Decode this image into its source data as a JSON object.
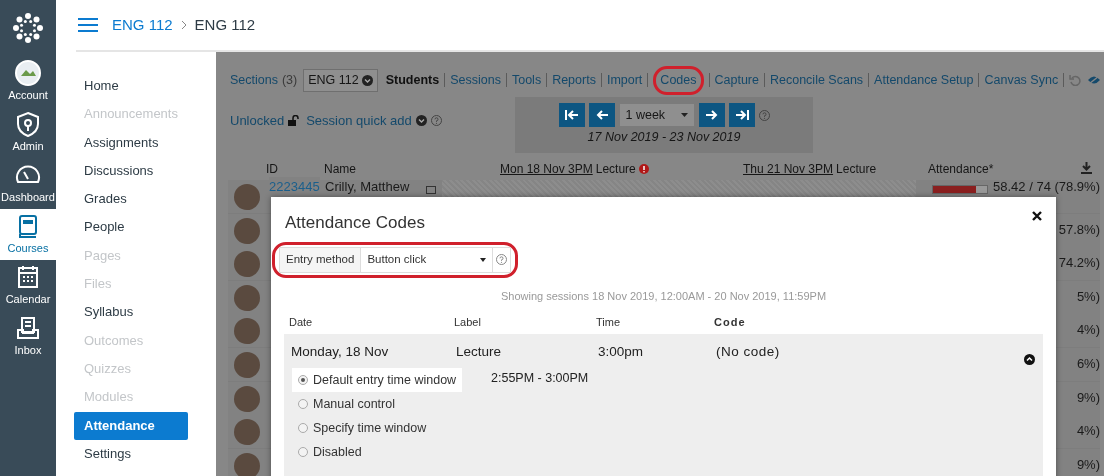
{
  "global_nav": [
    {
      "label": "Account",
      "selected": false
    },
    {
      "label": "Admin",
      "selected": false
    },
    {
      "label": "Dashboard",
      "selected": false
    },
    {
      "label": "Courses",
      "selected": true
    },
    {
      "label": "Calendar",
      "selected": false
    },
    {
      "label": "Inbox",
      "selected": false
    }
  ],
  "breadcrumb": [
    "ENG 112",
    "ENG 112"
  ],
  "course_nav": [
    {
      "label": "Home",
      "disabled": false,
      "selected": false
    },
    {
      "label": "Announcements",
      "disabled": true,
      "selected": false
    },
    {
      "label": "Assignments",
      "disabled": false,
      "selected": false
    },
    {
      "label": "Discussions",
      "disabled": false,
      "selected": false
    },
    {
      "label": "Grades",
      "disabled": false,
      "selected": false
    },
    {
      "label": "People",
      "disabled": false,
      "selected": false
    },
    {
      "label": "Pages",
      "disabled": true,
      "selected": false
    },
    {
      "label": "Files",
      "disabled": true,
      "selected": false
    },
    {
      "label": "Syllabus",
      "disabled": false,
      "selected": false
    },
    {
      "label": "Outcomes",
      "disabled": true,
      "selected": false
    },
    {
      "label": "Quizzes",
      "disabled": true,
      "selected": false
    },
    {
      "label": "Modules",
      "disabled": true,
      "selected": false
    },
    {
      "label": "Attendance",
      "disabled": false,
      "selected": true
    },
    {
      "label": "Settings",
      "disabled": false,
      "selected": false
    }
  ],
  "toolbar": {
    "sections_label": "Sections",
    "sections_count": "(3)",
    "section_select": "ENG 112",
    "links": [
      {
        "label": "Students",
        "selected": true,
        "highlighted": false
      },
      {
        "label": "Sessions",
        "selected": false,
        "highlighted": false
      },
      {
        "label": "Tools",
        "selected": false,
        "highlighted": false
      },
      {
        "label": "Reports",
        "selected": false,
        "highlighted": false
      },
      {
        "label": "Import",
        "selected": false,
        "highlighted": false
      },
      {
        "label": "Codes",
        "selected": false,
        "highlighted": true
      },
      {
        "label": "Capture",
        "selected": false,
        "highlighted": false
      },
      {
        "label": "Reconcile Scans",
        "selected": false,
        "highlighted": false
      },
      {
        "label": "Attendance Setup",
        "selected": false,
        "highlighted": false
      },
      {
        "label": "Canvas Sync",
        "selected": false,
        "highlighted": false
      }
    ]
  },
  "lock": {
    "label": "Unlocked"
  },
  "quick_add": {
    "label": "Session quick add"
  },
  "range": {
    "period": "1 week",
    "dates": "17 Nov 2019 - 23 Nov 2019"
  },
  "table": {
    "columns": [
      {
        "label": "ID"
      },
      {
        "label": "Name"
      },
      {
        "date": "Mon 18 Nov 3PM",
        "label": "Lecture",
        "alert": true
      },
      {
        "date": "Thu 21 Nov 3PM",
        "label": "Lecture",
        "alert": false
      },
      {
        "label": "Attendance*"
      }
    ],
    "rows": [
      {
        "id": "2223445",
        "name": "Crilly, Matthew",
        "attendance": "58.42 / 74 (78.9%)",
        "level": 0.789
      },
      {
        "attendance": "57.8%)"
      },
      {
        "attendance": "74.2%)"
      },
      {
        "attendance": "5%)"
      },
      {
        "attendance": "4%)"
      },
      {
        "attendance": "6%)"
      },
      {
        "attendance": "9%)"
      },
      {
        "attendance": "4%)"
      },
      {
        "attendance": "9%)"
      }
    ]
  },
  "modal": {
    "title": "Attendance Codes",
    "entry_method_label": "Entry method",
    "entry_method": "Button click",
    "entry_method_highlighted": true,
    "note": "Showing sessions 18 Nov 2019, 12:00AM - 20 Nov 2019, 11:59PM",
    "columns": [
      "Date",
      "Label",
      "Time",
      "Code"
    ],
    "sessions": [
      {
        "date": "Monday, 18 Nov",
        "label": "Lecture",
        "time": "3:00pm",
        "code": "(No code)",
        "expanded": true,
        "window": "2:55PM - 3:00PM",
        "options": [
          {
            "label": "Default entry time window",
            "selected": true
          },
          {
            "label": "Manual control",
            "selected": false
          },
          {
            "label": "Specify time window",
            "selected": false
          },
          {
            "label": "Disabled",
            "selected": false
          }
        ]
      }
    ]
  }
}
